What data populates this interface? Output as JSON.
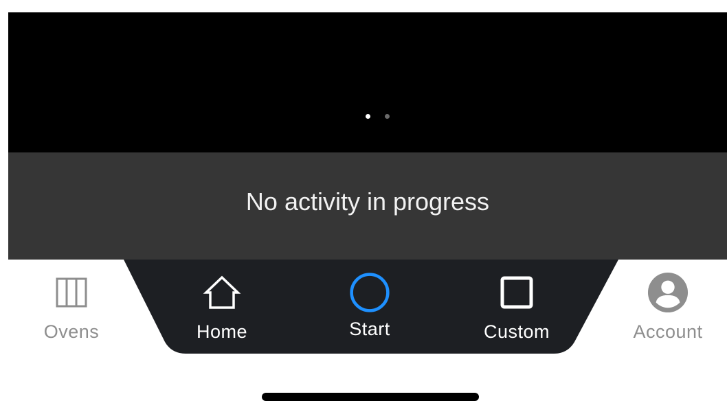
{
  "carousel": {
    "page_count": 2,
    "active_page": 1
  },
  "status": {
    "message": "No activity in progress"
  },
  "tabs": [
    {
      "id": "ovens",
      "label": "Ovens",
      "icon": "ovens-icon"
    },
    {
      "id": "home",
      "label": "Home",
      "icon": "home-icon"
    },
    {
      "id": "start",
      "label": "Start",
      "icon": "start-circle-icon"
    },
    {
      "id": "custom",
      "label": "Custom",
      "icon": "square-icon"
    },
    {
      "id": "account",
      "label": "Account",
      "icon": "account-icon"
    }
  ],
  "colors": {
    "hero_bg": "#000000",
    "status_bg": "#363636",
    "tabbar_dark": "#1d1f23",
    "accent_blue": "#1e90ff",
    "inactive_gray": "#8e8e8e"
  }
}
